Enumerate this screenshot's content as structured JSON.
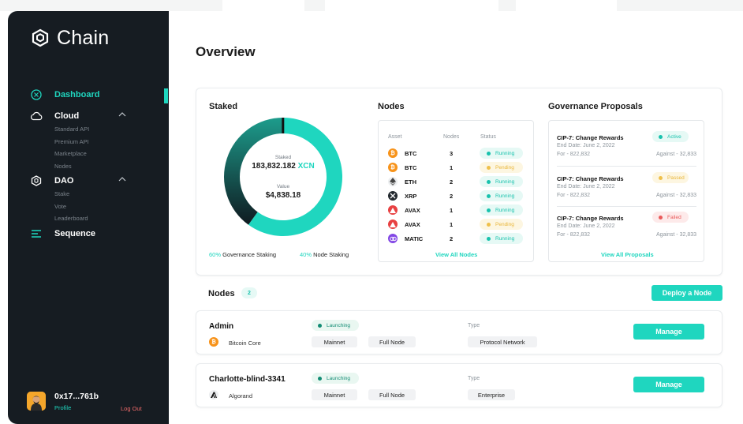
{
  "colors": {
    "accent": "#1fd6bf",
    "sidebar_bg": "#161c22",
    "running": "#18c2ad",
    "pending": "#efc04a",
    "failed": "#ea5a5a",
    "logout": "#ef6a6a"
  },
  "sidebar": {
    "logo": "Chain",
    "nav": [
      {
        "label": "Dashboard",
        "icon": "dashboard-icon",
        "active": true,
        "subitems": []
      },
      {
        "label": "Cloud",
        "icon": "cloud-icon",
        "expanded": true,
        "subitems": [
          "Standard API",
          "Premium API",
          "Marketplace",
          "Nodes"
        ]
      },
      {
        "label": "DAO",
        "icon": "dao-icon",
        "expanded": true,
        "subitems": [
          "Stake",
          "Vote",
          "Leaderboard"
        ]
      },
      {
        "label": "Sequence",
        "icon": "sequence-icon",
        "subitems": []
      }
    ],
    "profile": {
      "address": "0x17...761b",
      "link": "Profile",
      "logout": "Log Out"
    }
  },
  "page": {
    "title": "Overview"
  },
  "staked": {
    "title": "Staked",
    "center_label": "Staked",
    "center_amount": "183,832.182",
    "center_unit": "XCN",
    "value_label": "Value",
    "value_amount": "$4,838.18",
    "segments": [
      {
        "pct": 60,
        "label": "Governance Staking"
      },
      {
        "pct": 40,
        "label": "Node Staking"
      }
    ],
    "legend": [
      {
        "pct": "60%",
        "label": "Governance Staking"
      },
      {
        "pct": "40%",
        "label": "Node Staking"
      }
    ]
  },
  "nodes_summary": {
    "title": "Nodes",
    "columns": [
      "Asset",
      "Nodes",
      "Status"
    ],
    "rows": [
      {
        "asset": "BTC",
        "coin": "btc",
        "nodes": "3",
        "status": "Running"
      },
      {
        "asset": "BTC",
        "coin": "btc",
        "nodes": "1",
        "status": "Pending"
      },
      {
        "asset": "ETH",
        "coin": "eth",
        "nodes": "2",
        "status": "Running"
      },
      {
        "asset": "XRP",
        "coin": "xrp",
        "nodes": "2",
        "status": "Running"
      },
      {
        "asset": "AVAX",
        "coin": "avax",
        "nodes": "1",
        "status": "Running"
      },
      {
        "asset": "AVAX",
        "coin": "avax",
        "nodes": "1",
        "status": "Pending"
      },
      {
        "asset": "MATIC",
        "coin": "matic",
        "nodes": "2",
        "status": "Running"
      }
    ],
    "view_all": "View All Nodes"
  },
  "governance": {
    "title": "Governance Proposals",
    "items": [
      {
        "title": "CIP-7: Change Rewards",
        "status": "Active",
        "end": "End Date: June 2, 2022",
        "for": "For - 822,832",
        "against": "Against - 32,833"
      },
      {
        "title": "CIP-7: Change Rewards",
        "status": "Passed",
        "end": "End Date: June 2, 2022",
        "for": "For - 822,832",
        "against": "Against - 32,833"
      },
      {
        "title": "CIP-7: Change Rewards",
        "status": "Failed",
        "end": "End Date: June 2, 2022",
        "for": "For - 822,832",
        "against": "Against - 32,833"
      }
    ],
    "view_all": "View All Proposals"
  },
  "nodes_section": {
    "title": "Nodes",
    "count": "2",
    "deploy_label": "Deploy a Node",
    "type_label": "Type",
    "manage_label": "Manage",
    "nodes": [
      {
        "name": "Admin",
        "coin": "btc",
        "client": "Bitcoin Core",
        "status": "Launching",
        "network": "Mainnet",
        "kind": "Full Node",
        "type": "Protocol Network"
      },
      {
        "name": "Charlotte-blind-3341",
        "coin": "algo",
        "client": "Algorand",
        "status": "Launching",
        "network": "Mainnet",
        "kind": "Full Node",
        "type": "Enterprise"
      }
    ]
  }
}
